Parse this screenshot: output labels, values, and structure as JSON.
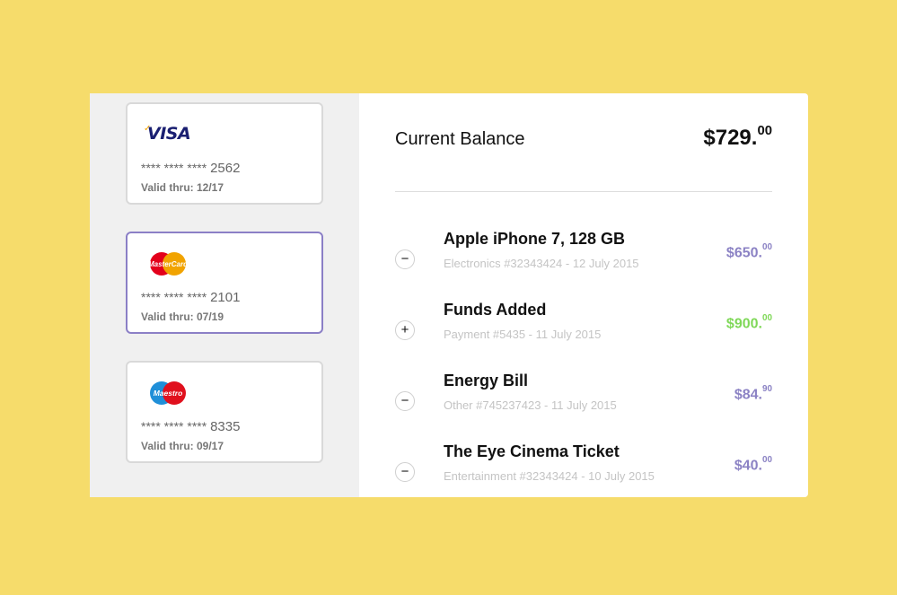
{
  "cards": [
    {
      "brand": "VISA",
      "masked": "**** **** ****",
      "last4": "2562",
      "valid": "Valid thru: 12/17",
      "selected": false
    },
    {
      "brand": "MasterCard",
      "masked": "**** **** ****",
      "last4": "2101",
      "valid": "Valid thru: 07/19",
      "selected": true
    },
    {
      "brand": "Maestro",
      "masked": "**** **** ****",
      "last4": "8335",
      "valid": "Valid thru: 09/17",
      "selected": false
    }
  ],
  "balance": {
    "label": "Current Balance",
    "whole": "$729.",
    "cents": "00"
  },
  "transactions": [
    {
      "sign": "−",
      "title": "Apple iPhone 7, 128 GB",
      "meta": "Electronics #32343424 - 12 July 2015",
      "whole": "$650.",
      "cents": "00",
      "color": "#8b82c4"
    },
    {
      "sign": "+",
      "title": "Funds Added",
      "meta": "Payment #5435 - 11 July 2015",
      "whole": "$900.",
      "cents": "00",
      "color": "#7fd858"
    },
    {
      "sign": "−",
      "title": "Energy Bill",
      "meta": "Other #745237423 - 11 July 2015",
      "whole": "$84.",
      "cents": "90",
      "color": "#8b82c4"
    },
    {
      "sign": "−",
      "title": "The Eye Cinema Ticket",
      "meta": "Entertainment #32343424 - 10 July 2015",
      "whole": "$40.",
      "cents": "00",
      "color": "#8b82c4"
    }
  ],
  "colors": {
    "background": "#f6dc6b",
    "accent": "#8b7fc6",
    "positive": "#7fd858",
    "negative": "#8b82c4"
  },
  "icons": {
    "minus": "minus-icon",
    "plus": "plus-icon"
  }
}
